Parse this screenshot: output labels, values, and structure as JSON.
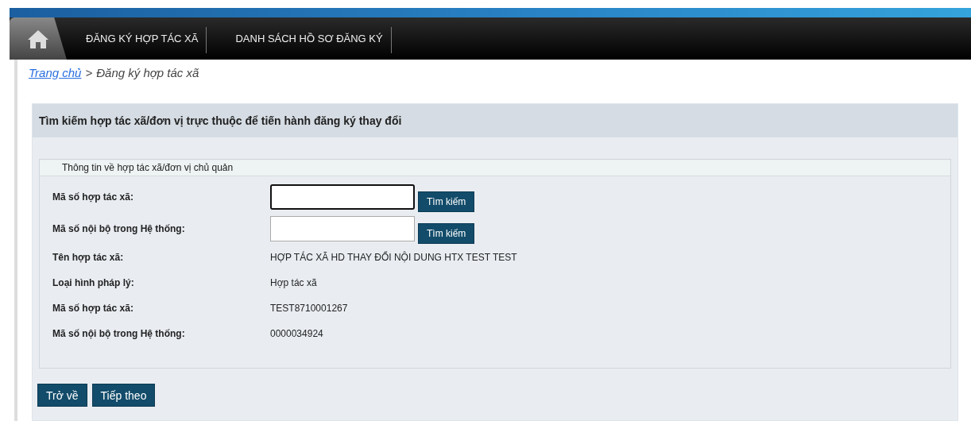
{
  "nav": {
    "items": [
      {
        "label": "ĐĂNG KÝ HỢP TÁC XÃ"
      },
      {
        "label": "DANH SÁCH HỒ SƠ ĐĂNG KÝ"
      }
    ]
  },
  "breadcrumb": {
    "link": "Trang chủ",
    "separator": ">",
    "current": "Đăng ký hợp tác xã"
  },
  "panel": {
    "title": "Tìm kiếm hợp tác xã/đơn vị trực thuộc để tiến hành đăng ký thay đổi",
    "section": "Thông tin về hợp tác xã/đơn vị chủ quản",
    "rows": [
      {
        "kind": "search",
        "label": "Mã số hợp tác xã:",
        "focused": true,
        "button": "Tìm kiếm"
      },
      {
        "kind": "search",
        "label": "Mã số nội bộ trong Hệ thống:",
        "focused": false,
        "button": "Tìm kiếm"
      },
      {
        "kind": "text",
        "label": "Tên hợp tác xã:",
        "value": "HỢP TÁC XÃ HD THAY ĐỔI NỘI DUNG HTX TEST TEST"
      },
      {
        "kind": "text",
        "label": "Loại hình pháp lý:",
        "value": "Hợp tác xã"
      },
      {
        "kind": "text",
        "label": "Mã số hợp tác xã:",
        "value": "TEST8710001267"
      },
      {
        "kind": "text",
        "label": "Mã số nội bộ trong Hệ thống:",
        "value": "0000034924"
      }
    ]
  },
  "buttons": [
    "Trở về",
    "Tiếp theo"
  ]
}
